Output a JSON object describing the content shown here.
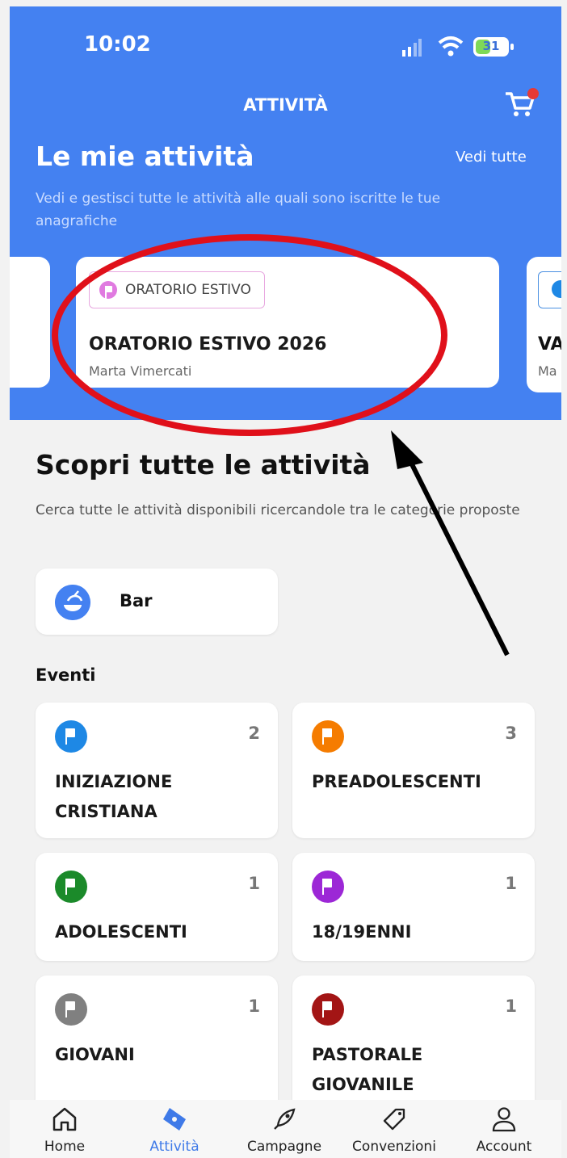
{
  "status_bar": {
    "time": "10:02",
    "battery": "31"
  },
  "nav": {
    "title": "ATTIVITÀ",
    "cart_icon": "cart-icon"
  },
  "my_activities": {
    "title": "Le mie attività",
    "see_all": "Vedi tutte",
    "description": "Vedi e gestisci tutte le attività alle quali sono iscritte le tue anagrafiche",
    "cards": [
      {
        "tag": "ORATORIO ESTIVO",
        "title": "ORATORIO ESTIVO 2026",
        "subtitle": "Marta Vimercati",
        "tag_color": "#e07ae0"
      },
      {
        "title": "VA",
        "subtitle": "Ma",
        "tag_color": "#1e88e5"
      }
    ]
  },
  "discover": {
    "title": "Scopri tutte le attività",
    "description": "Cerca tutte le attività disponibili ricercandole tra le categorie proposte",
    "bar_label": "Bar"
  },
  "events": {
    "title": "Eventi",
    "items": [
      {
        "label": "INIZIAZIONE CRISTIANA",
        "count": "2",
        "color": "#1e88e5"
      },
      {
        "label": "PREADOLESCENTI",
        "count": "3",
        "color": "#f57c00"
      },
      {
        "label": "ADOLESCENTI",
        "count": "1",
        "color": "#1b8a2a"
      },
      {
        "label": "18/19ENNI",
        "count": "1",
        "color": "#9c27d6"
      },
      {
        "label": "GIOVANI",
        "count": "1",
        "color": "#808080"
      },
      {
        "label": "PASTORALE GIOVANILE",
        "count": "1",
        "color": "#a31515"
      }
    ]
  },
  "tabs": [
    {
      "label": "Home",
      "icon": "home-icon"
    },
    {
      "label": "Attività",
      "icon": "ticket-icon",
      "active": true
    },
    {
      "label": "Campagne",
      "icon": "rocket-icon"
    },
    {
      "label": "Convenzioni",
      "icon": "tag-icon"
    },
    {
      "label": "Account",
      "icon": "user-icon"
    }
  ],
  "colors": {
    "header": "#4481f1",
    "annotation": "#e0101a",
    "active_tab": "#3f7ae8"
  }
}
